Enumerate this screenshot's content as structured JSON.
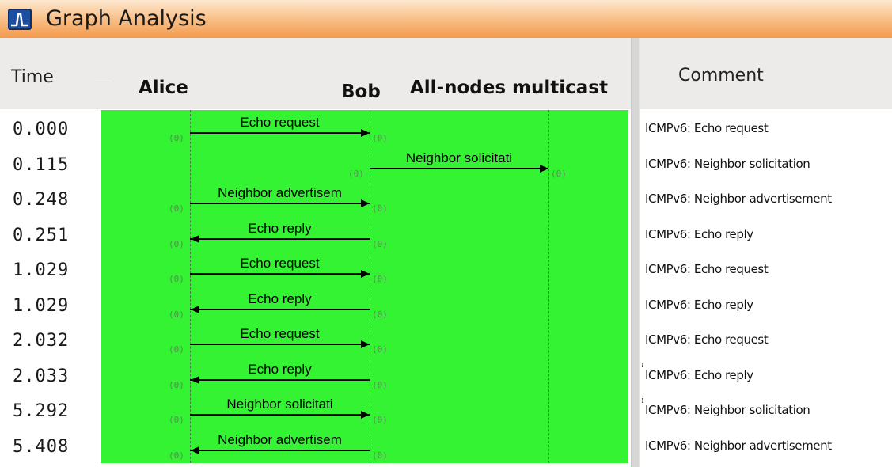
{
  "window": {
    "title": "Graph Analysis"
  },
  "columns": {
    "time": "Time",
    "comment": "Comment"
  },
  "nodes": [
    "Alice",
    "Bob",
    "All-nodes multicast"
  ],
  "rows": [
    {
      "time": "0.000",
      "label": "Echo request",
      "from": 0,
      "to": 1,
      "src_port": "(0)",
      "dst_port": "(0)",
      "comment": "ICMPv6: Echo request"
    },
    {
      "time": "0.115",
      "label": "Neighbor solicitati",
      "from": 1,
      "to": 2,
      "src_port": "(0)",
      "dst_port": "(0)",
      "comment": "ICMPv6: Neighbor solicitation"
    },
    {
      "time": "0.248",
      "label": "Neighbor advertisem",
      "from": 0,
      "to": 1,
      "src_port": "(0)",
      "dst_port": "(0)",
      "comment": "ICMPv6: Neighbor advertisement"
    },
    {
      "time": "0.251",
      "label": "Echo reply",
      "from": 1,
      "to": 0,
      "src_port": "(0)",
      "dst_port": "(0)",
      "comment": "ICMPv6: Echo reply"
    },
    {
      "time": "1.029",
      "label": "Echo request",
      "from": 0,
      "to": 1,
      "src_port": "(0)",
      "dst_port": "(0)",
      "comment": "ICMPv6: Echo request"
    },
    {
      "time": "1.029",
      "label": "Echo reply",
      "from": 1,
      "to": 0,
      "src_port": "(0)",
      "dst_port": "(0)",
      "comment": "ICMPv6: Echo reply"
    },
    {
      "time": "2.032",
      "label": "Echo request",
      "from": 0,
      "to": 1,
      "src_port": "(0)",
      "dst_port": "(0)",
      "comment": "ICMPv6: Echo request"
    },
    {
      "time": "2.033",
      "label": "Echo reply",
      "from": 1,
      "to": 0,
      "src_port": "(0)",
      "dst_port": "(0)",
      "comment": "ICMPv6: Echo reply"
    },
    {
      "time": "5.292",
      "label": "Neighbor solicitati",
      "from": 0,
      "to": 1,
      "src_port": "(0)",
      "dst_port": "(0)",
      "comment": "ICMPv6: Neighbor solicitation"
    },
    {
      "time": "5.408",
      "label": "Neighbor advertisem",
      "from": 1,
      "to": 0,
      "src_port": "(0)",
      "dst_port": "(0)",
      "comment": "ICMPv6: Neighbor advertisement"
    }
  ],
  "colors": {
    "diagram_bg": "#33f333",
    "titlebar": "#f39a4c",
    "header_bg": "#ecebe9"
  },
  "icons": {
    "app": "graph-analysis-icon"
  }
}
